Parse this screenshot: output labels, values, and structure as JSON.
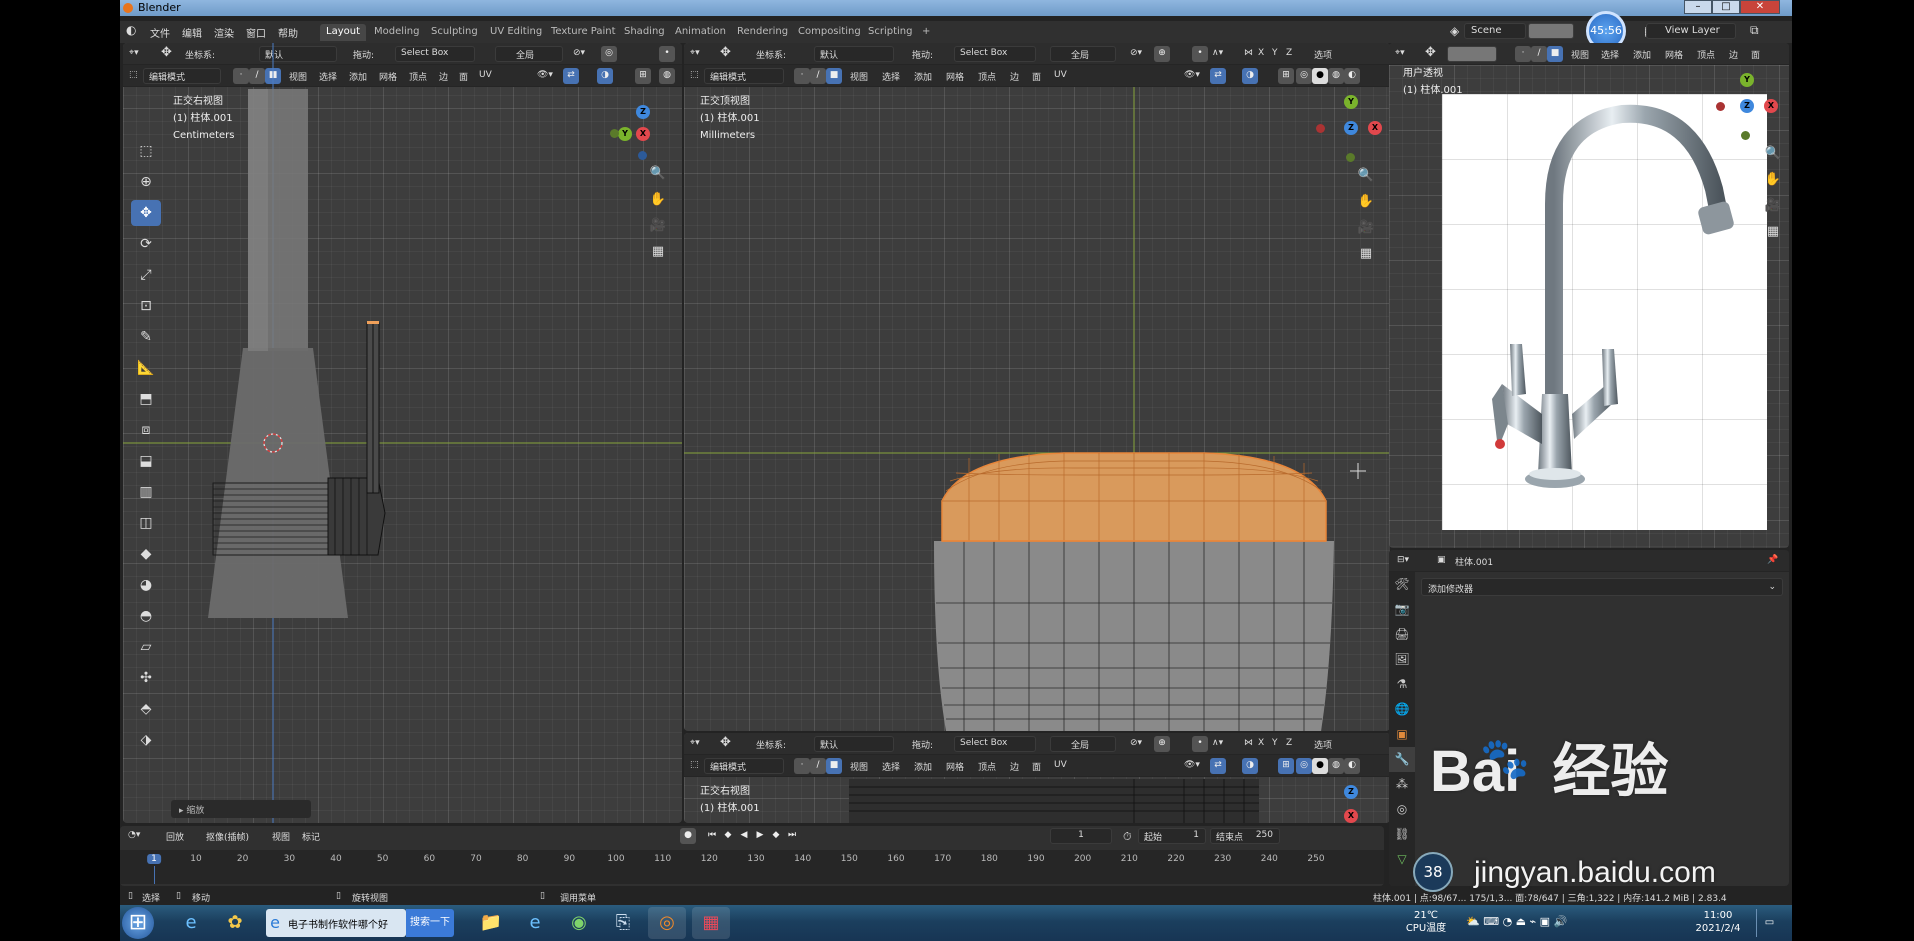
{
  "titlebar": {
    "title": "Blender"
  },
  "menu": [
    "文件",
    "编辑",
    "渲染",
    "窗口",
    "帮助"
  ],
  "tabs": [
    "Layout",
    "Modeling",
    "Sculpting",
    "UV Editing",
    "Texture Paint",
    "Shading",
    "Animation",
    "Rendering",
    "Compositing",
    "Scripting"
  ],
  "tab_add": "+",
  "top_right": {
    "scene": "Scene",
    "view_layer": "View Layer",
    "timer": "45:56"
  },
  "left_view": {
    "hdr": {
      "coord_label": "坐标系:",
      "coord_value": "默认",
      "drag_label": "拖动:",
      "drag_value": "Select Box",
      "global": "全局"
    },
    "hdr2": {
      "mode": "编辑模式",
      "view": "视图",
      "select": "选择",
      "add": "添加",
      "mesh": "网格",
      "vertex": "顶点",
      "edge": "边",
      "face": "面",
      "uv": "UV"
    },
    "overlay": [
      "正交右视图",
      "(1) 柱体.001",
      "Centimeters"
    ],
    "panel": "缩放"
  },
  "center_view": {
    "hdr": {
      "coord_label": "坐标系:",
      "coord_value": "默认",
      "drag_label": "拖动:",
      "drag_value": "Select Box",
      "global": "全局",
      "xyz": [
        "X",
        "Y",
        "Z"
      ],
      "options": "选项"
    },
    "hdr2": {
      "mode": "编辑模式",
      "view": "视图",
      "select": "选择",
      "add": "添加",
      "mesh": "网格",
      "vertex": "顶点",
      "edge": "边",
      "face": "面",
      "uv": "UV"
    },
    "overlay": [
      "正交顶视图",
      "(1) 柱体.001",
      "Millimeters"
    ]
  },
  "bottom_view": {
    "hdr": {
      "coord_label": "坐标系:",
      "coord_value": "默认",
      "drag_label": "拖动:",
      "drag_value": "Select Box",
      "global": "全局",
      "xyz": [
        "X",
        "Y",
        "Z"
      ],
      "options": "选项"
    },
    "hdr2": {
      "mode": "编辑模式",
      "view": "视图",
      "select": "选择",
      "add": "添加",
      "mesh": "网格",
      "vertex": "顶点",
      "edge": "边",
      "face": "面",
      "uv": "UV"
    },
    "overlay": [
      "正交右视图",
      "(1) 柱体.001"
    ]
  },
  "right_view": {
    "hdr": {
      "view": "视图",
      "select": "选择",
      "add": "添加",
      "mesh": "网格",
      "vertex": "顶点",
      "edge": "边",
      "face": "面"
    },
    "overlay": [
      "用户透视",
      "(1) 柱体.001"
    ]
  },
  "properties": {
    "object": "柱体.001",
    "add_modifier": "添加修改器"
  },
  "timeline": {
    "menus": [
      "回放",
      "抠像(插帧)",
      "视图",
      "标记"
    ],
    "current_frame": "1",
    "start_label": "起始",
    "start": "1",
    "end_label": "结束点",
    "end": "250",
    "ticks": [
      "1",
      "10",
      "20",
      "30",
      "40",
      "50",
      "60",
      "70",
      "80",
      "90",
      "100",
      "110",
      "120",
      "130",
      "140",
      "150",
      "160",
      "170",
      "180",
      "190",
      "200",
      "210",
      "220",
      "230",
      "240",
      "250"
    ]
  },
  "status": {
    "select": "选择",
    "move": "移动",
    "rotate": "旋转视图",
    "menu": "调用菜单",
    "stats": "柱体.001 | 点:98/67... 175/1,3... 面:78/647 | 三角:1,322 | 内存:141.2 MiB | 2.83.4"
  },
  "taskbar": {
    "ie_tab": "电子书制作软件哪个好",
    "search_btn": "搜索一下",
    "weather_temp": "21℃",
    "weather_label": "CPU温度",
    "time": "11:00",
    "date": "2021/2/4"
  },
  "watermark": {
    "brand": "Bai  经验",
    "url": "jingyan.baidu.com",
    "bubble": "38"
  },
  "colors": {
    "select_orange": "#f0a05a",
    "accent_blue": "#4772b3",
    "x_red": "#e2484d",
    "y_green": "#7ab32c",
    "z_blue": "#3f88dd"
  }
}
